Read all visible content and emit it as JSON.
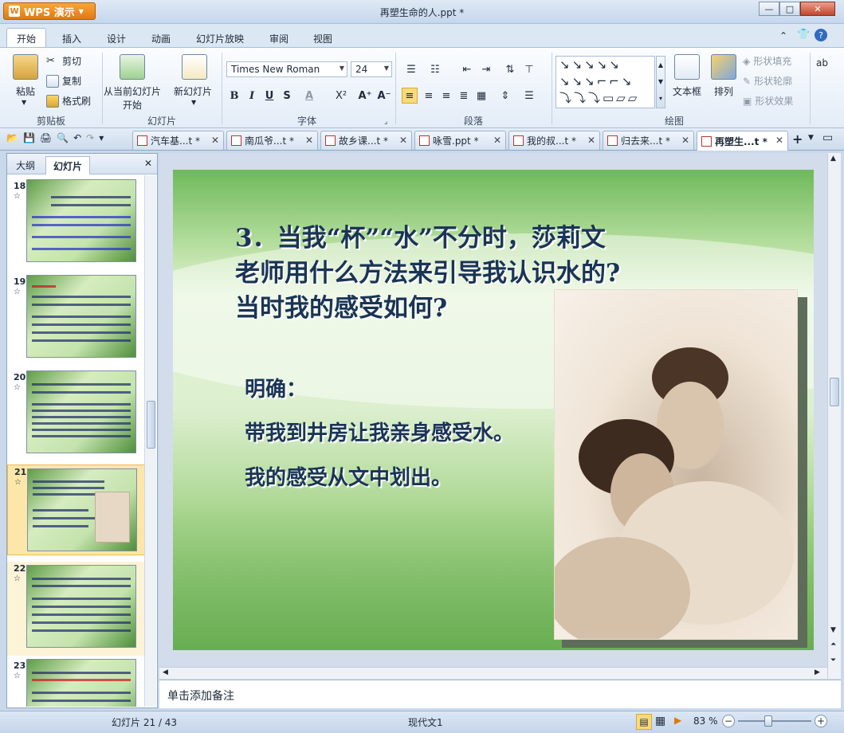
{
  "window": {
    "app_button": "WPS 演示",
    "title": "再塑生命的人.ppt *",
    "min": "—",
    "max": "□",
    "close": "✕"
  },
  "ribbon_tabs": [
    "开始",
    "插入",
    "设计",
    "动画",
    "幻灯片放映",
    "审阅",
    "视图"
  ],
  "ribbon": {
    "clipboard": {
      "paste": "粘贴",
      "cut": "剪切",
      "copy": "复制",
      "format_painter": "格式刷",
      "group": "剪贴板"
    },
    "slides": {
      "from_current": "从当前幻灯片",
      "start": "开始",
      "new_slide": "新幻灯片",
      "group": "幻灯片"
    },
    "font": {
      "family": "Times New Roman",
      "size": "24",
      "bold": "B",
      "italic": "I",
      "underline": "U",
      "shadow": "S",
      "color": "A",
      "superscript": "X²",
      "grow": "A⁺",
      "shrink": "A⁻",
      "group": "字体"
    },
    "paragraph": {
      "group": "段落"
    },
    "drawing": {
      "textbox": "文本框",
      "arrange": "排列",
      "shape_fill": "形状填充",
      "shape_outline": "形状轮廓",
      "shape_effects": "形状效果",
      "group": "绘图"
    }
  },
  "doc_tabs": [
    "汽车基...t *",
    "南瓜爷...t *",
    "故乡课...t *",
    "咏雪.ppt *",
    "我的叔...t *",
    "归去来...t *",
    "再塑生...t *"
  ],
  "left_panel": {
    "tabs": [
      "大纲",
      "幻灯片"
    ],
    "close": "✕",
    "slides": [
      {
        "num": "18",
        "star": "☆"
      },
      {
        "num": "19",
        "star": "☆"
      },
      {
        "num": "20",
        "star": "☆"
      },
      {
        "num": "21",
        "star": "☆"
      },
      {
        "num": "22",
        "star": "☆"
      },
      {
        "num": "23",
        "star": "☆"
      }
    ]
  },
  "slide": {
    "title_line1": "3．当我“杯”“水”不分时，莎莉文",
    "title_line2": "老师用什么方法来引导我认识水的?",
    "title_line3": "当时我的感受如何?",
    "answer_label": "明确：",
    "answer1": "带我到井房让我亲身感受水。",
    "answer2": "我的感受从文中划出。"
  },
  "notes_placeholder": "单击添加备注",
  "status": {
    "slide_counter": "幻灯片 21 / 43",
    "template": "现代文1",
    "zoom": "83 %",
    "zoom_level_percent": 83
  },
  "colors": {
    "title_text": "#1a3456",
    "accent_orange": "#e07a10",
    "selected_thumb": "#fde7a8"
  }
}
